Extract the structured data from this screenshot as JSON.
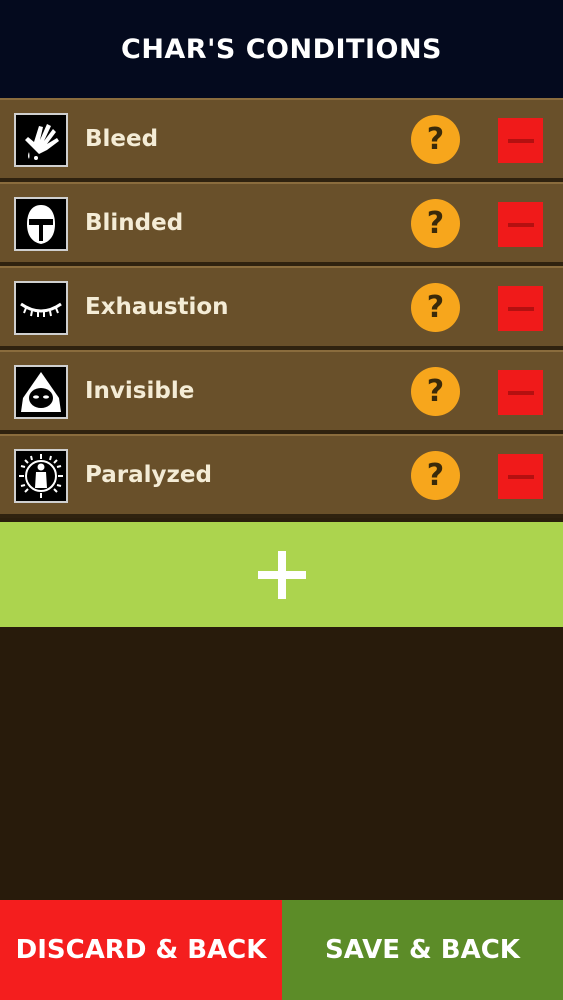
{
  "header": {
    "title": "CHAR'S CONDITIONS"
  },
  "conditions": [
    {
      "label": "Bleed",
      "icon": "bleed-hand-icon"
    },
    {
      "label": "Blinded",
      "icon": "blinded-helmet-icon"
    },
    {
      "label": "Exhaustion",
      "icon": "exhaustion-closed-eye-icon"
    },
    {
      "label": "Invisible",
      "icon": "invisible-hood-icon"
    },
    {
      "label": "Paralyzed",
      "icon": "paralyzed-figure-icon"
    }
  ],
  "row_actions": {
    "help_glyph": "?",
    "remove_icon": "minus-icon"
  },
  "add_button": {
    "icon": "plus-icon"
  },
  "footer": {
    "discard_label": "DISCARD & BACK",
    "save_label": "SAVE & BACK"
  },
  "colors": {
    "header_bg": "#040a1e",
    "row_bg": "#69502a",
    "help": "#f7a61c",
    "remove": "#f01a1a",
    "add": "#acd44e",
    "discard": "#f41e1e",
    "save": "#5c8c28"
  }
}
